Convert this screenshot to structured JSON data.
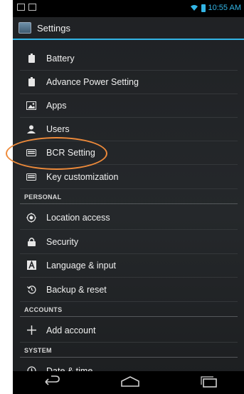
{
  "status_bar": {
    "time": "10:55 AM"
  },
  "action_bar": {
    "title": "Settings"
  },
  "rows": [
    {
      "id": "battery",
      "label": "Battery"
    },
    {
      "id": "advance-power",
      "label": "Advance Power Setting"
    },
    {
      "id": "apps",
      "label": "Apps"
    },
    {
      "id": "users",
      "label": "Users"
    },
    {
      "id": "bcr",
      "label": "BCR Setting"
    },
    {
      "id": "key-customization",
      "label": "Key customization"
    }
  ],
  "sections": {
    "personal": "PERSONAL",
    "accounts": "ACCOUNTS",
    "system": "SYSTEM"
  },
  "personal_rows": [
    {
      "id": "location",
      "label": "Location access"
    },
    {
      "id": "security",
      "label": "Security"
    },
    {
      "id": "language",
      "label": "Language & input"
    },
    {
      "id": "backup",
      "label": "Backup & reset"
    }
  ],
  "accounts_rows": [
    {
      "id": "add-account",
      "label": "Add account"
    }
  ],
  "system_rows": [
    {
      "id": "date-time",
      "label": "Date & time"
    }
  ],
  "colors": {
    "accent": "#33b5e5",
    "annotation": "#ee8a3a"
  }
}
